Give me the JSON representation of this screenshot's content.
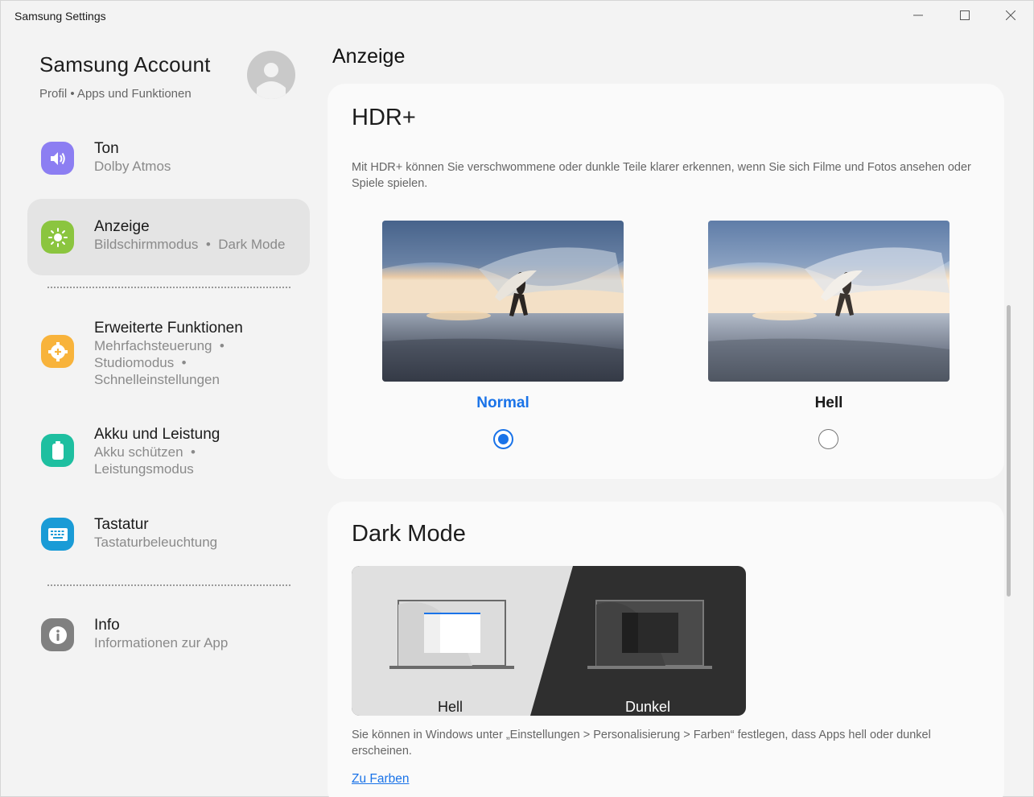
{
  "window": {
    "title": "Samsung Settings"
  },
  "account": {
    "title": "Samsung Account",
    "subtitle": "Profil • Apps und Funktionen"
  },
  "sidebar": {
    "items": [
      {
        "label": "Ton",
        "sub": "Dolby Atmos",
        "icon": "speaker-icon",
        "color": "#8c7ef2"
      },
      {
        "label": "Anzeige",
        "sub": "Bildschirmmodus  •  Dark Mode",
        "icon": "sun-icon",
        "color": "#8bc53f"
      },
      {
        "label": "Erweiterte Funktionen",
        "sub_lines": [
          "Mehrfachsteuerung  •",
          "Studiomodus  •",
          "Schnelleinstellungen"
        ],
        "icon": "gear-plus-icon",
        "color": "#f8b33b"
      },
      {
        "label": "Akku und Leistung",
        "sub_lines": [
          "Akku schützen  •",
          "Leistungsmodus"
        ],
        "icon": "battery-icon",
        "color": "#1ebfa0"
      },
      {
        "label": "Tastatur",
        "sub": "Tastaturbeleuchtung",
        "icon": "keyboard-icon",
        "color": "#1a9bd6"
      },
      {
        "label": "Info",
        "sub": "Informationen zur App",
        "icon": "info-icon",
        "color": "#808080"
      }
    ]
  },
  "main": {
    "title": "Anzeige",
    "hdr": {
      "title": "HDR+",
      "description": "Mit HDR+ können Sie verschwommene oder dunkle Teile klarer erkennen, wenn Sie sich Filme und Fotos ansehen oder Spiele spielen.",
      "options": [
        {
          "label": "Normal",
          "selected": true
        },
        {
          "label": "Hell",
          "selected": false
        }
      ]
    },
    "dark_mode": {
      "title": "Dark Mode",
      "light_label": "Hell",
      "dark_label": "Dunkel",
      "description": "Sie können in Windows unter „Einstellungen > Personalisierung > Farben“ festlegen, dass Apps hell oder dunkel erscheinen.",
      "link": "Zu Farben"
    }
  },
  "colors": {
    "accent": "#1a73e8",
    "card": "#fafafa",
    "background": "#f3f3f3"
  }
}
